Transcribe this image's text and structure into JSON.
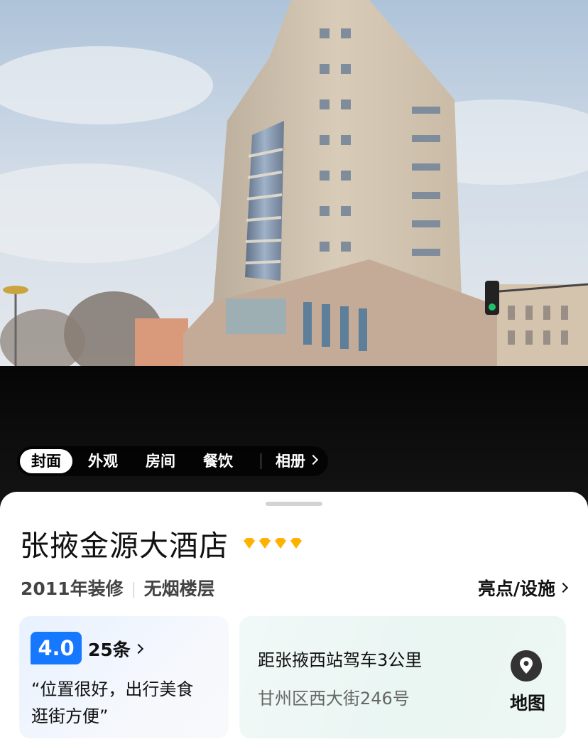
{
  "hero": {
    "tabs": [
      {
        "label": "封面",
        "active": true
      },
      {
        "label": "外观",
        "active": false
      },
      {
        "label": "房间",
        "active": false
      },
      {
        "label": "餐饮",
        "active": false
      }
    ],
    "album_label": "相册"
  },
  "hotel": {
    "name": "张掖金源大酒店",
    "diamond_rating": 4,
    "diamond_color": "#ffb300",
    "renovated": "2011年装修",
    "no_smoking": "无烟楼层",
    "highlights_link": "亮点/设施"
  },
  "review": {
    "score": "4.0",
    "count": "25条",
    "quote_line1": "“位置很好，出行美食",
    "quote_line2": "逛街方便”",
    "score_color": "#1677ff"
  },
  "location": {
    "distance": "距张掖西站驾车3公里",
    "address": "甘州区西大街246号",
    "map_label": "地图",
    "map_icon": "map-pin-icon"
  }
}
